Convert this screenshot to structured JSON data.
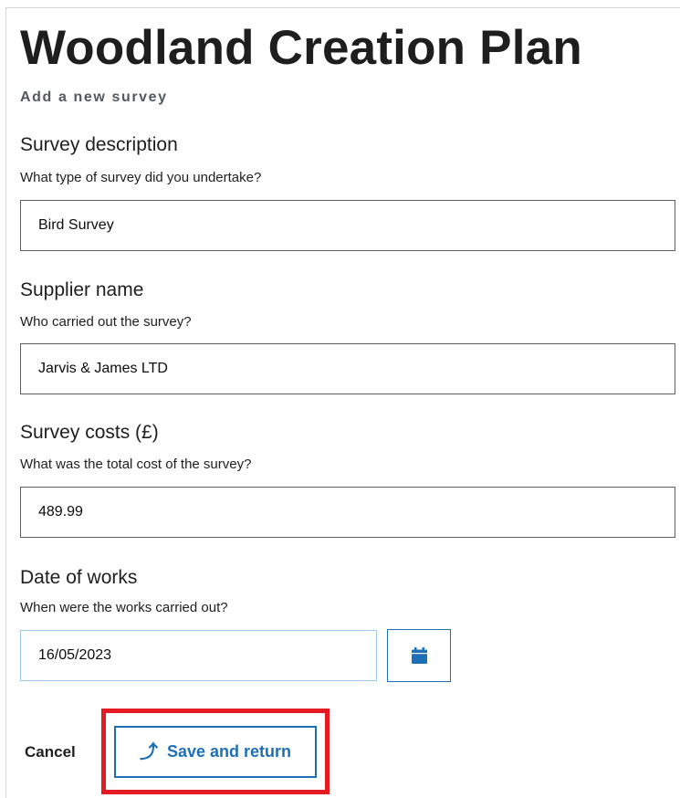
{
  "page": {
    "title": "Woodland Creation Plan",
    "caption": "Add a new survey"
  },
  "form": {
    "survey_description": {
      "label": "Survey description",
      "hint": "What type of survey did you undertake?",
      "value": "Bird Survey"
    },
    "supplier_name": {
      "label": "Supplier name",
      "hint": "Who carried out the survey?",
      "value": "Jarvis & James LTD"
    },
    "survey_costs": {
      "label": "Survey costs (£)",
      "hint": "What was the total cost of the survey?",
      "value": "489.99"
    },
    "date_of_works": {
      "label": "Date of works",
      "hint": "When were the works carried out?",
      "value": "16/05/2023",
      "picker_icon": "calendar-icon"
    }
  },
  "actions": {
    "cancel_label": "Cancel",
    "save_label": "Save and return",
    "save_icon": "upload-arrow-icon"
  },
  "colors": {
    "link_blue": "#1d70b8",
    "highlight_red": "#e41b23",
    "caption_grey": "#505a5f"
  }
}
